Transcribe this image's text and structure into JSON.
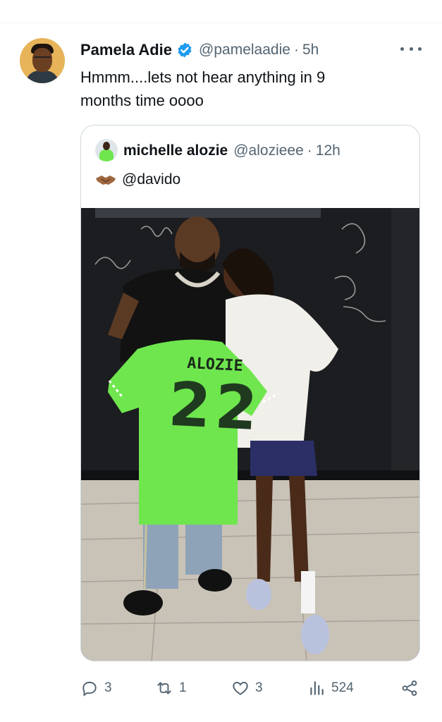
{
  "tweet": {
    "author_name": "Pamela Adie",
    "author_handle": "@pamelaadie",
    "separator": "·",
    "time": "5h",
    "text": "Hmmm....lets not hear anything in 9 months time oooo"
  },
  "quoted": {
    "author_name": "michelle alozie",
    "author_handle": "@alozieee",
    "separator": "·",
    "time": "12h",
    "text": "@davido"
  },
  "photo": {
    "jersey_name": "ALOZIE",
    "jersey_number": "22"
  },
  "actions": {
    "replies": "3",
    "reposts": "1",
    "likes": "3",
    "views": "524"
  },
  "colors": {
    "verified_blue": "#1d9bf0",
    "secondary_text": "#536471",
    "jersey_green": "#6fe64e"
  }
}
